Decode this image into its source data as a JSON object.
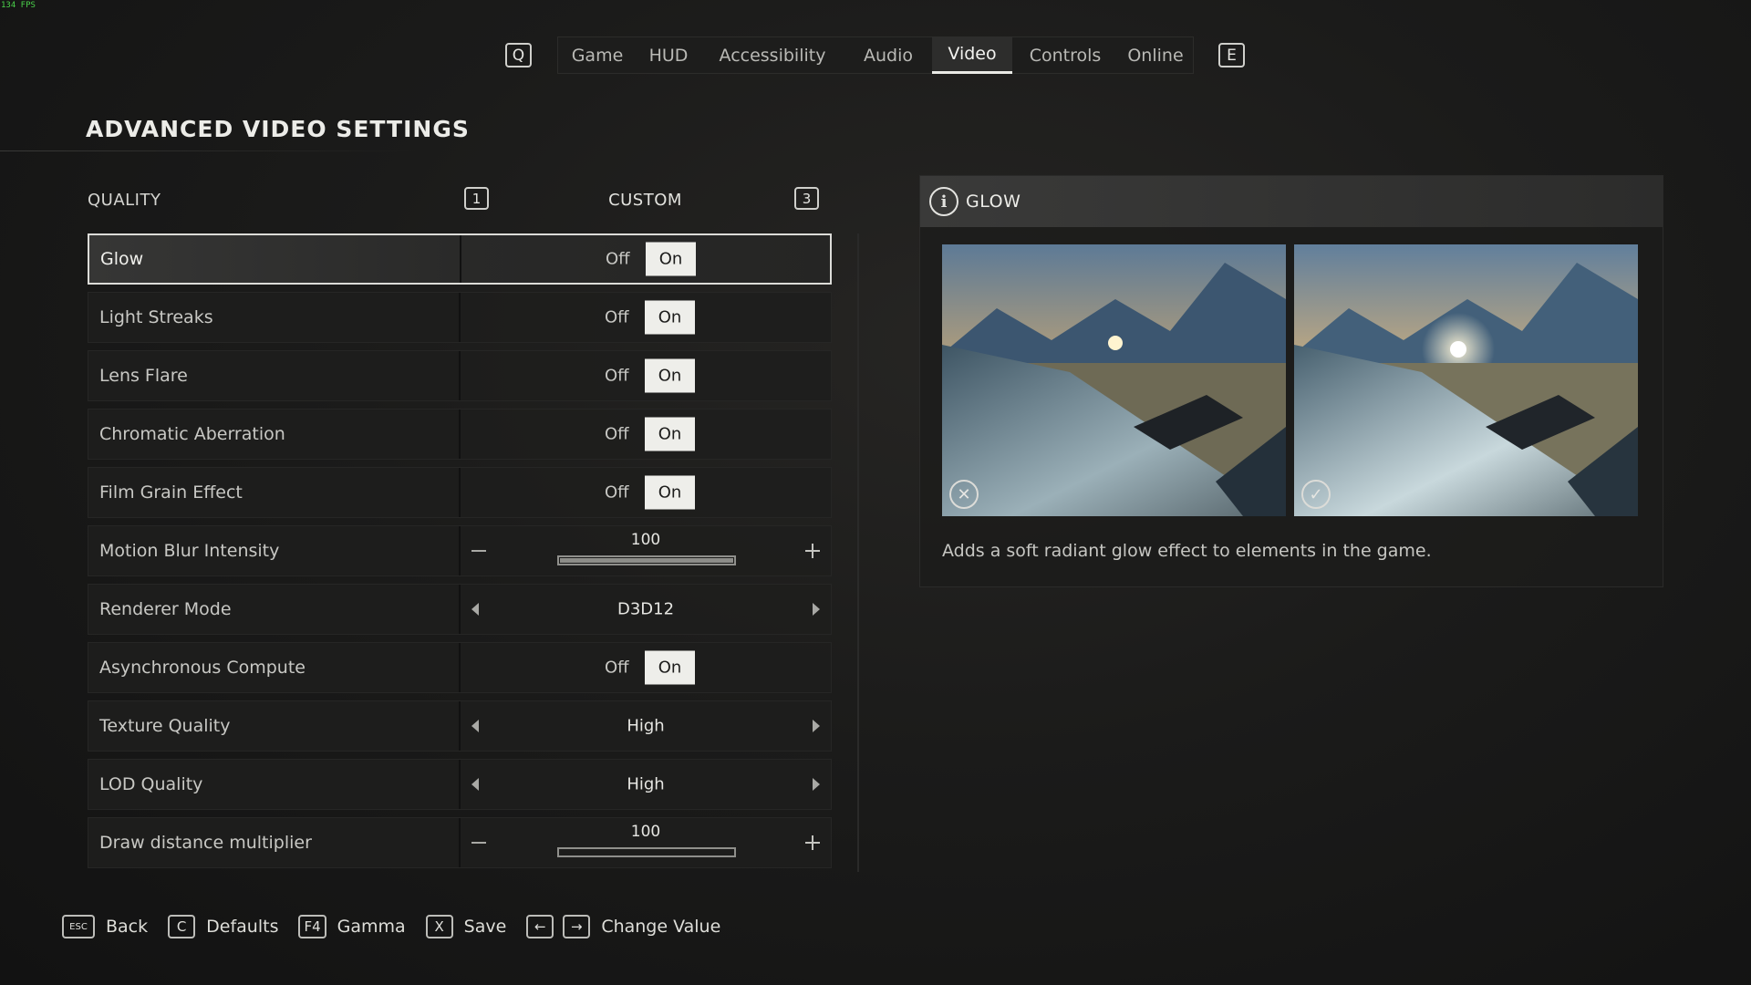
{
  "fps": "134 FPS",
  "nav": {
    "prev_key": "Q",
    "next_key": "E",
    "tabs": [
      {
        "label": "Game",
        "active": false
      },
      {
        "label": "HUD",
        "active": false
      },
      {
        "label": "Accessibility",
        "active": false
      },
      {
        "label": "Audio",
        "active": false
      },
      {
        "label": "Video",
        "active": true
      },
      {
        "label": "Controls",
        "active": false
      },
      {
        "label": "Online",
        "active": false
      }
    ]
  },
  "page_title": "ADVANCED VIDEO SETTINGS",
  "quality": {
    "label": "QUALITY",
    "prev_key": "1",
    "value": "CUSTOM",
    "next_key": "3"
  },
  "settings": [
    {
      "name": "Glow",
      "type": "toggle",
      "off": "Off",
      "on": "On",
      "value": "On"
    },
    {
      "name": "Light Streaks",
      "type": "toggle",
      "off": "Off",
      "on": "On",
      "value": "On"
    },
    {
      "name": "Lens Flare",
      "type": "toggle",
      "off": "Off",
      "on": "On",
      "value": "On"
    },
    {
      "name": "Chromatic Aberration",
      "type": "toggle",
      "off": "Off",
      "on": "On",
      "value": "On"
    },
    {
      "name": "Film Grain Effect",
      "type": "toggle",
      "off": "Off",
      "on": "On",
      "value": "On"
    },
    {
      "name": "Motion Blur Intensity",
      "type": "slider",
      "value": "100",
      "fill": 1.0
    },
    {
      "name": "Renderer Mode",
      "type": "select",
      "value": "D3D12"
    },
    {
      "name": "Asynchronous Compute",
      "type": "toggle",
      "off": "Off",
      "on": "On",
      "value": "On"
    },
    {
      "name": "Texture Quality",
      "type": "select",
      "value": "High"
    },
    {
      "name": "LOD Quality",
      "type": "select",
      "value": "High"
    },
    {
      "name": "Draw distance multiplier",
      "type": "slider",
      "value": "100",
      "fill": 0.0
    }
  ],
  "info": {
    "title": "GLOW",
    "description": "Adds a soft radiant glow effect to elements in the game.",
    "preview_off_icon": "x-circle-icon",
    "preview_on_icon": "check-circle-icon"
  },
  "footer": [
    {
      "key": "ESC",
      "label": "Back"
    },
    {
      "key": "C",
      "label": "Defaults"
    },
    {
      "key": "F4",
      "label": "Gamma"
    },
    {
      "key": "X",
      "label": "Save"
    },
    {
      "key": "←",
      "key2": "→",
      "label": "Change Value"
    }
  ]
}
